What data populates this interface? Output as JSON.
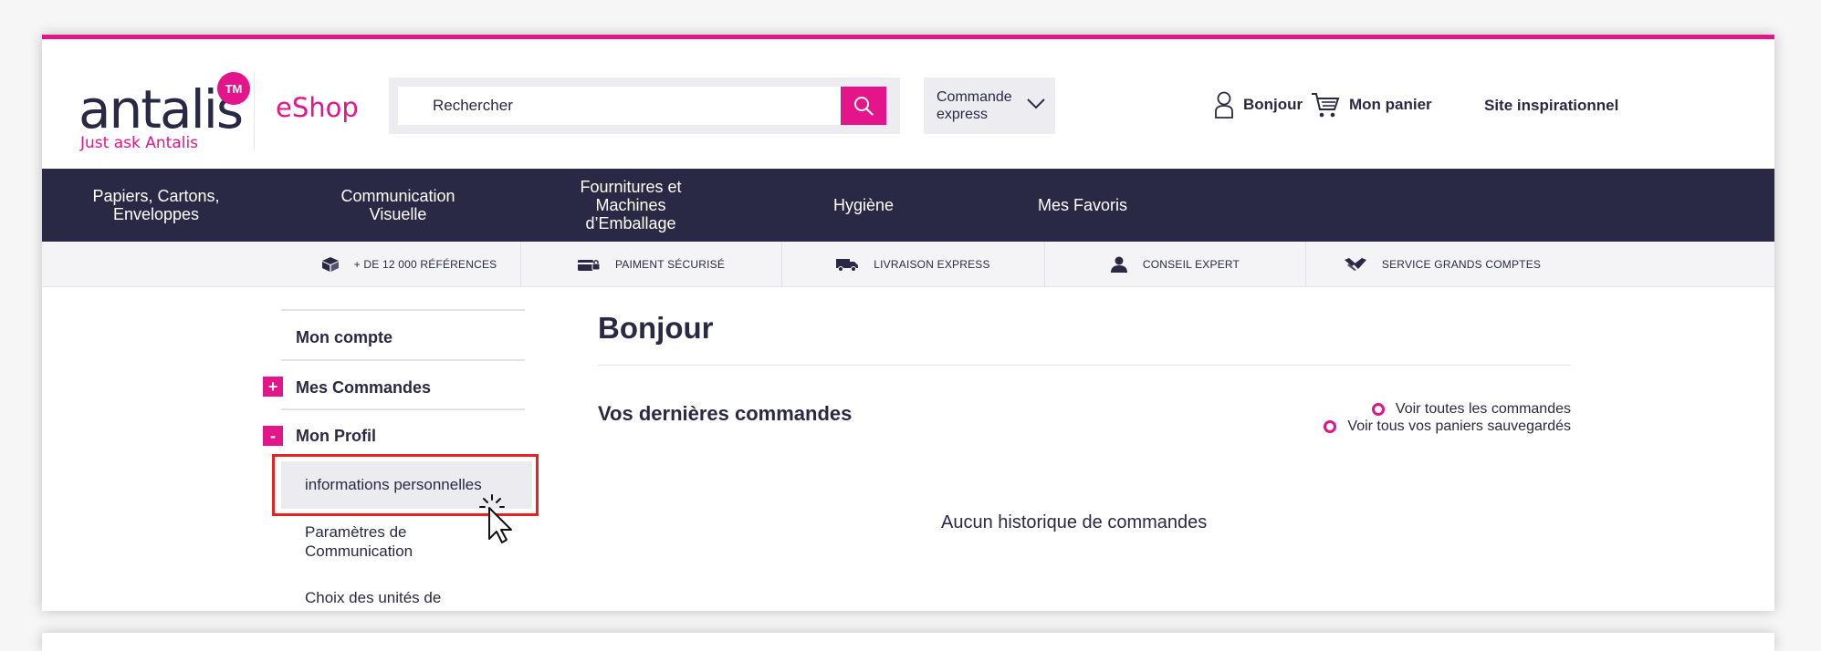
{
  "brand": {
    "logo_text": "antalis",
    "logo_badge": "TM",
    "tagline": "Just ask Antalis",
    "shop_name": "eShop",
    "accent_color": "#e4148b",
    "dark_color": "#2a2945"
  },
  "header": {
    "search_placeholder": "Rechercher",
    "search_icon": "magnifier-icon",
    "express_label": "Commande express",
    "user_label": "Bonjour",
    "cart_label": "Mon panier",
    "inspiration_label": "Site inspirationnel"
  },
  "menu": {
    "items": [
      {
        "label": "Papiers, Cartons, Enveloppes"
      },
      {
        "label": "Communication Visuelle"
      },
      {
        "label": "Fournitures et Machines d’Emballage"
      },
      {
        "label": "Hygiène"
      },
      {
        "label": "Mes Favoris"
      }
    ]
  },
  "reassurance": {
    "items": [
      {
        "label": "+ DE 12 000 RÉFÉRENCES",
        "icon": "box-icon"
      },
      {
        "label": "PAIMENT SÉCURISÉ",
        "icon": "secure-card-icon"
      },
      {
        "label": "LIVRAISON EXPRESS",
        "icon": "truck-icon"
      },
      {
        "label": "CONSEIL EXPERT",
        "icon": "person-icon"
      },
      {
        "label": "SERVICE GRANDS COMPTES",
        "icon": "handshake-icon"
      }
    ]
  },
  "sidebar": {
    "account": "Mon compte",
    "orders": "Mes Commandes",
    "orders_toggle": "+",
    "profile": "Mon Profil",
    "profile_toggle": "-",
    "profile_items": [
      {
        "label": "informations personnelles"
      },
      {
        "label": "Paramètres de Communication"
      },
      {
        "label": "Choix des unités de"
      }
    ]
  },
  "content": {
    "title": "Bonjour",
    "orders_title": "Vos dernières commandes",
    "link_all_orders": "Voir toutes les commandes",
    "link_saved_carts": "Voir tous vos paniers sauvegardés",
    "empty_message": "Aucun historique de commandes"
  }
}
